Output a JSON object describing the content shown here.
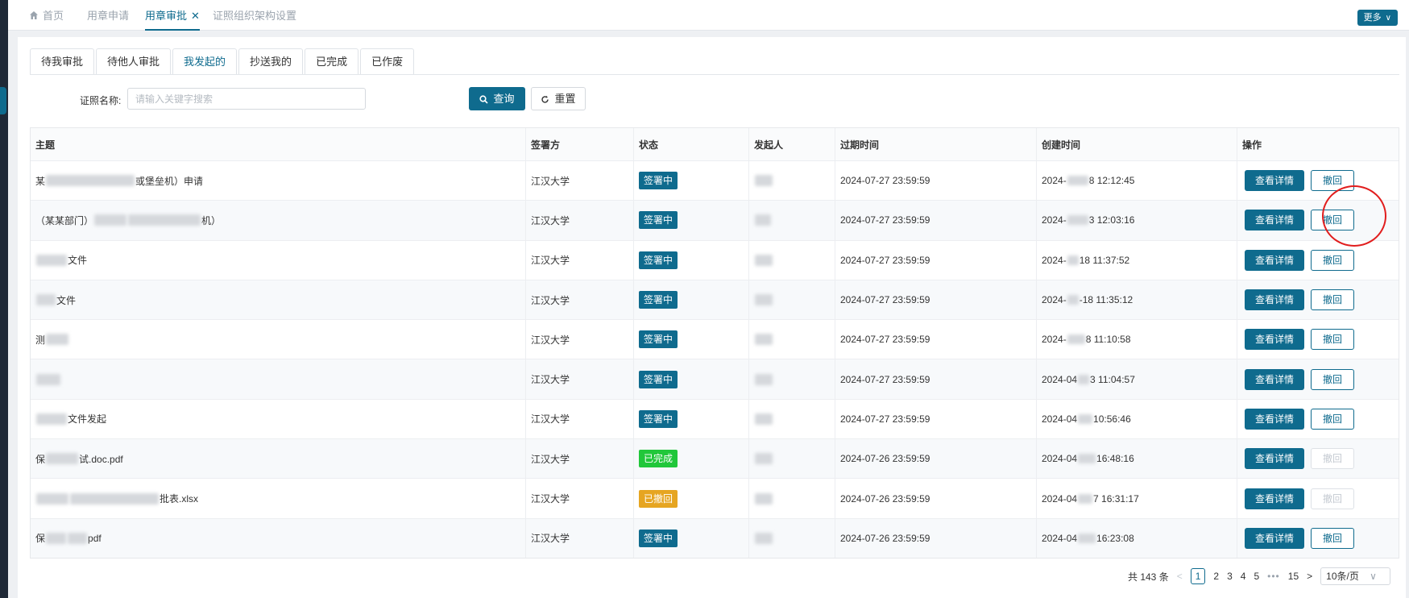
{
  "tabs": [
    {
      "label": "首页",
      "icon": "home-icon",
      "active": false
    },
    {
      "label": "用章申请",
      "active": false
    },
    {
      "label": "用章审批",
      "active": true,
      "closable": true
    },
    {
      "label": "证照组织架构设置",
      "active": false
    }
  ],
  "more_label": "更多",
  "subtabs": [
    "待我审批",
    "待他人审批",
    "我发起的",
    "抄送我的",
    "已完成",
    "已作废"
  ],
  "active_subtab": 2,
  "filter": {
    "label": "证照名称:",
    "placeholder": "请输入关键字搜索"
  },
  "buttons": {
    "query": "查询",
    "reset": "重置"
  },
  "table": {
    "columns": [
      "主题",
      "签署方",
      "状态",
      "发起人",
      "过期时间",
      "创建时间",
      "操作"
    ],
    "rows": [
      {
        "subject_prefix": "某",
        "subject_suffix": "或堡垒机）申请",
        "signer": "江汉大学",
        "status": "签署中",
        "status_kind": "signing",
        "expire": "2024-07-27 23:59:59",
        "created_prefix": "2024-",
        "created_suffix": "8 12:12:45",
        "withdraw_enabled": true
      },
      {
        "subject_prefix": "（某某部门）",
        "subject_suffix": "机）",
        "signer": "江汉大学",
        "status": "签署中",
        "status_kind": "signing",
        "expire": "2024-07-27 23:59:59",
        "created_prefix": "2024-",
        "created_suffix": "3 12:03:16",
        "withdraw_enabled": true
      },
      {
        "subject_prefix": "",
        "subject_suffix": "文件",
        "signer": "江汉大学",
        "status": "签署中",
        "status_kind": "signing",
        "expire": "2024-07-27 23:59:59",
        "created_prefix": "2024-",
        "created_suffix": "18 11:37:52",
        "withdraw_enabled": true
      },
      {
        "subject_prefix": "",
        "subject_suffix": "文件",
        "signer": "江汉大学",
        "status": "签署中",
        "status_kind": "signing",
        "expire": "2024-07-27 23:59:59",
        "created_prefix": "2024-",
        "created_suffix": "-18 11:35:12",
        "withdraw_enabled": true
      },
      {
        "subject_prefix": "测",
        "subject_suffix": "",
        "signer": "江汉大学",
        "status": "签署中",
        "status_kind": "signing",
        "expire": "2024-07-27 23:59:59",
        "created_prefix": "2024-",
        "created_suffix": "8 11:10:58",
        "withdraw_enabled": true
      },
      {
        "subject_prefix": "",
        "subject_suffix": "",
        "signer": "江汉大学",
        "status": "签署中",
        "status_kind": "signing",
        "expire": "2024-07-27 23:59:59",
        "created_prefix": "2024-04",
        "created_suffix": "3 11:04:57",
        "withdraw_enabled": true
      },
      {
        "subject_prefix": "",
        "subject_suffix": "文件发起",
        "signer": "江汉大学",
        "status": "签署中",
        "status_kind": "signing",
        "expire": "2024-07-27 23:59:59",
        "created_prefix": "2024-04",
        "created_suffix": "10:56:46",
        "withdraw_enabled": true
      },
      {
        "subject_prefix": "保",
        "subject_suffix": "试.doc.pdf",
        "signer": "江汉大学",
        "status": "已完成",
        "status_kind": "done",
        "expire": "2024-07-26 23:59:59",
        "created_prefix": "2024-04",
        "created_suffix": "16:48:16",
        "withdraw_enabled": false
      },
      {
        "subject_prefix": "",
        "subject_suffix": "批表.xlsx",
        "signer": "江汉大学",
        "status": "已撤回",
        "status_kind": "withdrawn",
        "expire": "2024-07-26 23:59:59",
        "created_prefix": "2024-04",
        "created_suffix": "7 16:31:17",
        "withdraw_enabled": false
      },
      {
        "subject_prefix": "保",
        "subject_suffix": "pdf",
        "signer": "江汉大学",
        "status": "签署中",
        "status_kind": "signing",
        "expire": "2024-07-26 23:59:59",
        "created_prefix": "2024-04",
        "created_suffix": "16:23:08",
        "withdraw_enabled": true
      }
    ],
    "action_detail": "查看详情",
    "action_withdraw": "撤回"
  },
  "pagination": {
    "total": "共 143 条",
    "pages": [
      "1",
      "2",
      "3",
      "4",
      "5"
    ],
    "current": "1",
    "ellipsis": "•••",
    "last": "15",
    "prev": "<",
    "next": ">",
    "page_size": "10条/页"
  },
  "colors": {
    "primary": "#0f6b8e",
    "done": "#21c73a",
    "withdrawn": "#e6a521",
    "annotation": "#e11d1d"
  }
}
